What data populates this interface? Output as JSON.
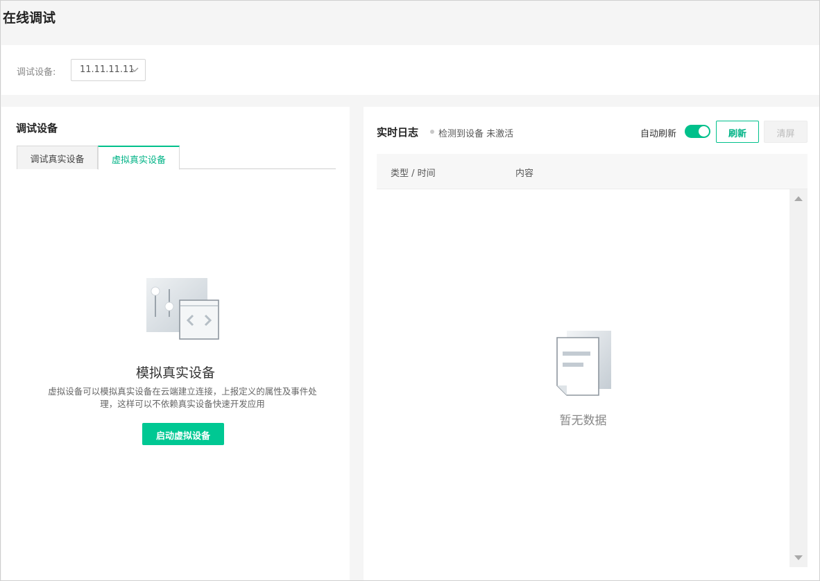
{
  "page": {
    "title": "在线调试"
  },
  "device": {
    "label": "调试设备:",
    "selected": "11.11.11.11"
  },
  "left": {
    "heading": "调试设备",
    "tabs": [
      {
        "label": "调试真实设备",
        "active": false
      },
      {
        "label": "虚拟真实设备",
        "active": true
      }
    ],
    "illustration_icon": "virtual-device-illustration",
    "title": "模拟真实设备",
    "description": "虚拟设备可以模拟真实设备在云端建立连接，上报定义的属性及事件处理，这样可以不依赖真实设备快速开发应用",
    "start_button": "启动虚拟设备"
  },
  "right": {
    "title": "实时日志",
    "status": "检测到设备 未激活",
    "auto_refresh_label": "自动刷新",
    "auto_refresh_on": true,
    "refresh_button": "刷新",
    "clear_button": "清屏",
    "columns": [
      "类型 / 时间",
      "内容"
    ],
    "empty_text": "暂无数据"
  },
  "colors": {
    "accent": "#00c08b",
    "button_bg": "#00c893"
  }
}
